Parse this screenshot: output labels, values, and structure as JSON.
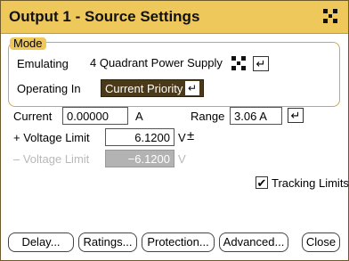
{
  "window": {
    "title": "Output 1 - Source Settings",
    "title_icon": "grid-icon"
  },
  "mode": {
    "section_label": "Mode",
    "emulating_label": "Emulating",
    "emulating_value": "4 Quadrant Power Supply",
    "operating_label": "Operating In",
    "operating_value": "Current Priority",
    "enter_glyph": "↵"
  },
  "settings": {
    "current_label": "Current",
    "current_value": "0.00000",
    "current_unit": "A",
    "range_label": "Range",
    "range_value": "3.06 A",
    "vlimit_pos_label": "+ Voltage Limit",
    "vlimit_pos_value": "6.1200",
    "vlimit_pos_unit": "V",
    "vlimit_pos_icon": "±",
    "vlimit_neg_label": "– Voltage Limit",
    "vlimit_neg_value": "−6.1200",
    "vlimit_neg_unit": "V",
    "tracking_label": "Tracking Limits",
    "tracking_checked": true,
    "check_glyph": "✔"
  },
  "buttons": {
    "delay": "Delay...",
    "ratings": "Ratings...",
    "protection": "Protection...",
    "advanced": "Advanced...",
    "close": "Close"
  },
  "colors": {
    "titlebar": "#efc85c",
    "priority_bg": "#4b3a1a",
    "disabled_field": "#b3b3b3"
  }
}
